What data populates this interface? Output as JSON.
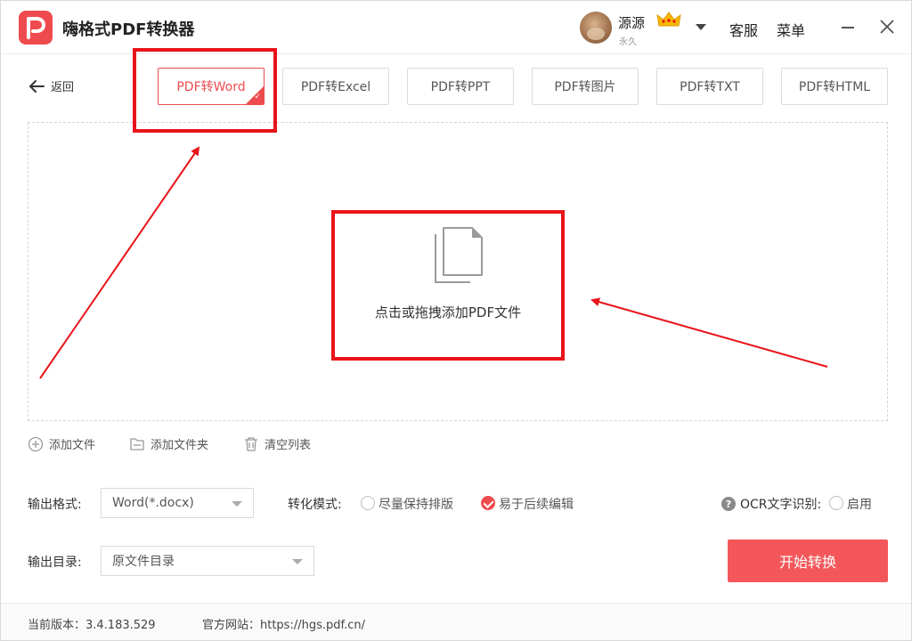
{
  "app": {
    "title": "嗨格式PDF转换器",
    "accent": "#ee4b4f"
  },
  "user": {
    "name": "源源",
    "membership": "永久",
    "vip_icon": "crown-icon"
  },
  "titlebar": {
    "service": "客服",
    "menu": "菜单"
  },
  "nav": {
    "back_label": "返回",
    "tabs": [
      {
        "label": "PDF转Word",
        "active": true
      },
      {
        "label": "PDF转Excel",
        "active": false
      },
      {
        "label": "PDF转PPT",
        "active": false
      },
      {
        "label": "PDF转图片",
        "active": false
      },
      {
        "label": "PDF转TXT",
        "active": false
      },
      {
        "label": "PDF转HTML",
        "active": false
      }
    ]
  },
  "dropzone": {
    "text": "点击或拖拽添加PDF文件"
  },
  "file_actions": {
    "add_file": "添加文件",
    "add_folder": "添加文件夹",
    "clear_list": "清空列表"
  },
  "options": {
    "output_format_label": "输出格式:",
    "output_format_value": "Word(*.docx)",
    "mode_label": "转化模式:",
    "mode_options": [
      {
        "label": "尽量保持排版",
        "selected": false
      },
      {
        "label": "易于后续编辑",
        "selected": true
      }
    ],
    "ocr_label": "OCR文字识别:",
    "ocr_enable_label": "启用",
    "ocr_enabled": false,
    "output_dir_label": "输出目录:",
    "output_dir_value": "原文件目录"
  },
  "actions": {
    "start_label": "开始转换"
  },
  "status": {
    "version": "当前版本：3.4.183.529",
    "website": "官方网站：https://hgs.pdf.cn/"
  }
}
